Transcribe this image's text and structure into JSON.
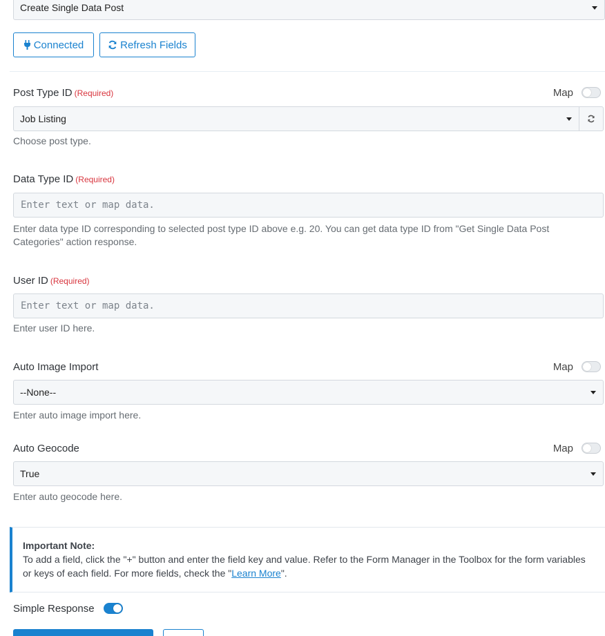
{
  "action_select": {
    "value": "Create Single Data Post"
  },
  "buttons": {
    "connected": "Connected",
    "refresh_fields": "Refresh Fields"
  },
  "fields": {
    "post_type": {
      "label": "Post Type ID",
      "required": "(Required)",
      "map": "Map",
      "value": "Job Listing",
      "help": "Choose post type."
    },
    "data_type": {
      "label": "Data Type ID",
      "required": "(Required)",
      "placeholder": "Enter text or map data.",
      "help": "Enter data type ID corresponding to selected post type ID above e.g. 20. You can get data type ID from \"Get Single Data Post Categories\" action response."
    },
    "user_id": {
      "label": "User ID",
      "required": "(Required)",
      "placeholder": "Enter text or map data.",
      "help": "Enter user ID here."
    },
    "auto_image_import": {
      "label": "Auto Image Import",
      "map": "Map",
      "value": "--None--",
      "help": "Enter auto image import here."
    },
    "auto_geocode": {
      "label": "Auto Geocode",
      "map": "Map",
      "value": "True",
      "help": "Enter auto geocode here."
    }
  },
  "note": {
    "title": "Important Note:",
    "text_before": "To add a field, click the \"+\" button and enter the field key and value. Refer to the Form Manager in the Toolbox for the form variables or keys of each field. For more fields, check the \"",
    "link": "Learn More",
    "text_after": "\"."
  },
  "simple_response": {
    "label": "Simple Response",
    "enabled": true
  },
  "colors": {
    "accent": "#1a82cf",
    "required": "#d8343d"
  }
}
